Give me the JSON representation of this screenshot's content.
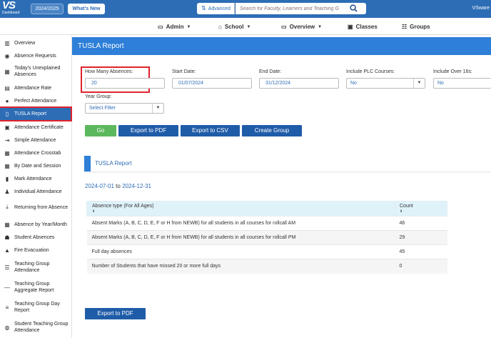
{
  "brand": {
    "logo": "VS",
    "sub": "Dashboard"
  },
  "topbar": {
    "year": "2024/2025",
    "whats_new": "What's New",
    "advanced": "Advanced",
    "search_placeholder": "Search for Faculty, Learners and Teaching G",
    "user": "VSware"
  },
  "nav": {
    "admin": "Admin",
    "school": "School",
    "overview": "Overview",
    "classes": "Classes",
    "groups": "Groups"
  },
  "sidebar": {
    "items": [
      {
        "label": "Overview",
        "icon": "columns-icon"
      },
      {
        "label": "Absence Requests",
        "icon": "search-icon"
      },
      {
        "label": "Today's Unexplained Absences",
        "icon": "calendar-icon"
      },
      {
        "label": "Attendance Rate",
        "icon": "grid-icon"
      },
      {
        "label": "Perfect Attendance",
        "icon": "circle-icon"
      },
      {
        "label": "TUSLA Report",
        "icon": "document-icon"
      },
      {
        "label": "Attendance Certificate",
        "icon": "certificate-icon"
      },
      {
        "label": "Simple Attendance",
        "icon": "login-icon"
      },
      {
        "label": "Attendance Crosstab",
        "icon": "table-icon"
      },
      {
        "label": "By Date and Session",
        "icon": "calendar-icon"
      },
      {
        "label": "Mark Attendance",
        "icon": "book-icon"
      },
      {
        "label": "Individual Attendance",
        "icon": "person-icon"
      },
      {
        "label": "Returning from Absence",
        "icon": "return-icon"
      },
      {
        "label": "Absence by Year/Month",
        "icon": "calendar-icon"
      },
      {
        "label": "Student Absences",
        "icon": "group-icon"
      },
      {
        "label": "Fire Evacuation",
        "icon": "fire-icon"
      },
      {
        "label": "Teaching Group Attendance",
        "icon": "list-icon"
      },
      {
        "label": "Teaching Group Aggregate Report",
        "icon": "lines-icon"
      },
      {
        "label": "Teaching Group Day Report",
        "icon": "lines-icon"
      },
      {
        "label": "Student Teaching Group Attendance",
        "icon": "globe-icon"
      }
    ]
  },
  "page": {
    "title": "TUSLA Report",
    "filters": {
      "absences_label": "How Many Absences:",
      "absences_value": "20",
      "start_label": "Start Date:",
      "start_value": "01/07/2024",
      "end_label": "End Date:",
      "end_value": "31/12/2024",
      "plc_label": "Include PLC Courses:",
      "plc_value": "No",
      "over16_label": "Include Over 16s:",
      "over16_value": "No",
      "year_group_label": "Year Group:",
      "year_group_value": "Select Filter"
    },
    "buttons": {
      "go": "Go",
      "export_pdf": "Export to PDF",
      "export_csv": "Export to CSV",
      "create_group": "Create Group",
      "export_pdf_bottom": "Export to PDF"
    },
    "report": {
      "title": "TUSLA Report",
      "date_from": "2024-07-01",
      "to_word": "to",
      "date_to": "2024-12-31",
      "columns": [
        "Absence type (For All Ages)",
        "Count"
      ],
      "rows": [
        {
          "type": "Absent Marks (A, B, C, D, E, F or H from NEWB) for all students in all courses for rollcall AM",
          "count": "46"
        },
        {
          "type": "Absent Marks (A, B, C, D, E, F or H from NEWB) for all students in all courses for rollcall PM",
          "count": "29"
        },
        {
          "type": "Full day absences",
          "count": "45"
        },
        {
          "type": "Number of Students that have missed 20 or more full days",
          "count": "0"
        }
      ]
    }
  },
  "colors": {
    "topbar": "#2d6db5",
    "header": "#2d7fd8",
    "highlight": "#e0242c",
    "go": "#5cb85c",
    "button": "#1f5ca8",
    "table_header": "#dff2f9"
  }
}
